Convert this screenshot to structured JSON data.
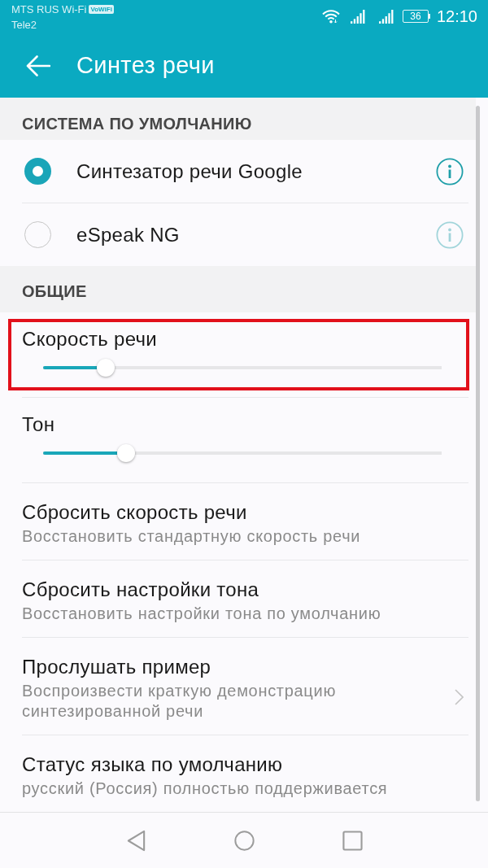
{
  "status_bar": {
    "carrier": "MTS RUS Wi-Fi",
    "carrier_badge": "VoWiFi",
    "carrier_2": "Tele2",
    "battery": "36",
    "time": "12:10"
  },
  "app_bar": {
    "title": "Синтез речи"
  },
  "sections": [
    {
      "header": "СИСТЕМА ПО УМОЛЧАНИЮ",
      "items": [
        {
          "kind": "radio",
          "label": "Синтезатор речи Google",
          "selected": true
        },
        {
          "kind": "radio",
          "label": "eSpeak NG",
          "selected": false
        }
      ]
    },
    {
      "header": "ОБЩИЕ",
      "items": [
        {
          "kind": "slider",
          "label": "Скорость речи",
          "level": 0.16,
          "highlighted": true
        },
        {
          "kind": "slider",
          "label": "Тон",
          "level": 0.21,
          "highlighted": false
        },
        {
          "kind": "action",
          "title": "Сбросить скорость речи",
          "subtitle": "Восстановить стандартную скорость речи",
          "has_chevron": false
        },
        {
          "kind": "action",
          "title": "Сбросить настройки тона",
          "subtitle": "Восстановить настройки тона по умолчанию",
          "has_chevron": false
        },
        {
          "kind": "action",
          "title": "Прослушать пример",
          "subtitle": "Воспроизвести краткую демонстрацию синтезированной речи",
          "has_chevron": true
        },
        {
          "kind": "action",
          "title": "Статус языка по умолчанию",
          "subtitle": "русский (Россия) полностью поддерживается",
          "has_chevron": false
        }
      ]
    }
  ]
}
